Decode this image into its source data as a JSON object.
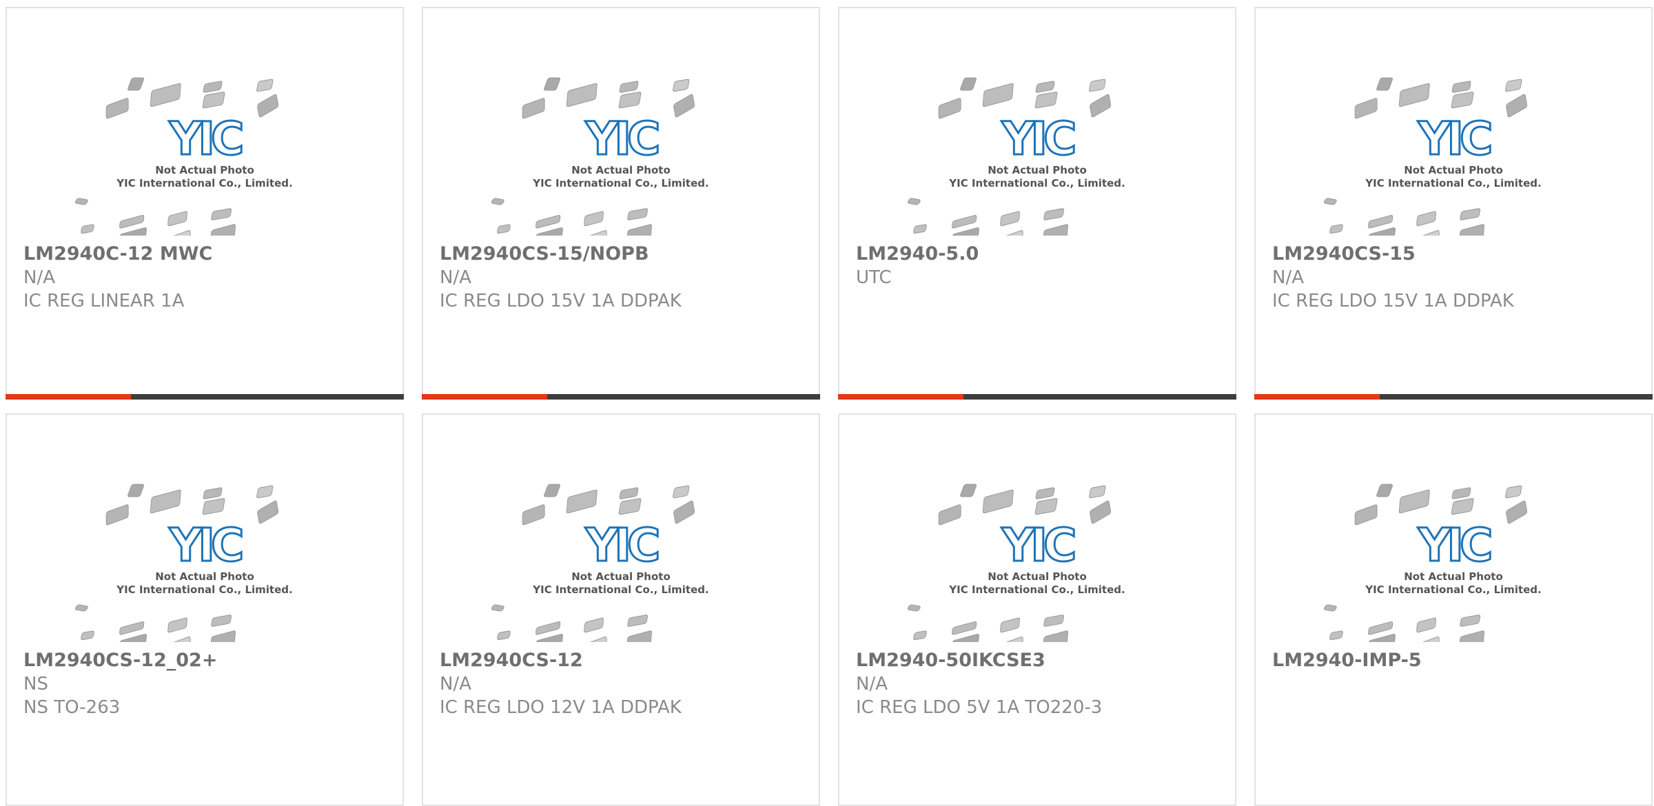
{
  "placeholder": {
    "brand": "YIC",
    "line1": "Not Actual Photo",
    "line2": "YIC International Co., Limited."
  },
  "colors": {
    "accent": "#e03a17",
    "bar": "#3e3e3e",
    "logo": "#1e73b8"
  },
  "products": [
    {
      "part": "LM2940C-12 MWC",
      "mfr": "N/A",
      "desc": "IC REG LINEAR 1A"
    },
    {
      "part": "LM2940CS-15/NOPB",
      "mfr": "N/A",
      "desc": "IC REG LDO 15V 1A DDPAK"
    },
    {
      "part": "LM2940-5.0",
      "mfr": "UTC",
      "desc": ""
    },
    {
      "part": "LM2940CS-15",
      "mfr": "N/A",
      "desc": "IC REG LDO 15V 1A DDPAK"
    },
    {
      "part": "LM2940CS-12_02+",
      "mfr": "NS",
      "desc": "NS TO-263"
    },
    {
      "part": "LM2940CS-12",
      "mfr": "N/A",
      "desc": "IC REG LDO 12V 1A DDPAK"
    },
    {
      "part": "LM2940-50IKCSE3",
      "mfr": "N/A",
      "desc": "IC REG LDO 5V 1A TO220-3"
    },
    {
      "part": "LM2940-IMP-5",
      "mfr": "",
      "desc": ""
    }
  ]
}
